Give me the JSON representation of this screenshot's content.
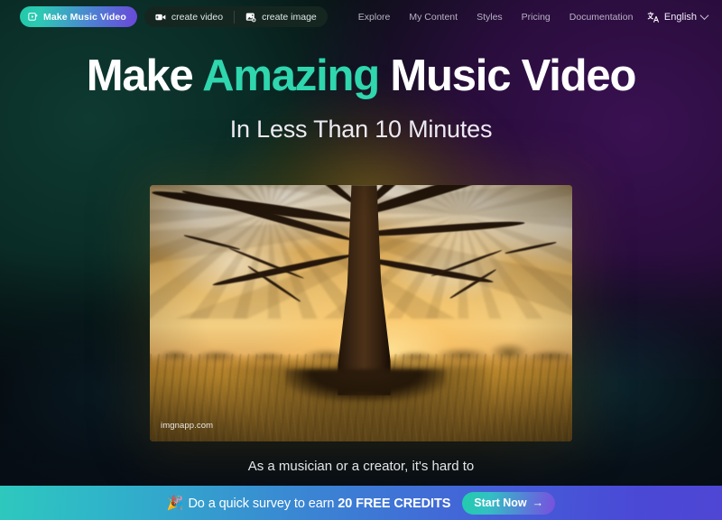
{
  "navbar": {
    "primary_pill": {
      "label": "Make Music Video",
      "icon": "video-play-square-icon"
    },
    "pills": [
      {
        "label": "create video",
        "icon": "video-camera-icon"
      },
      {
        "label": "create image",
        "icon": "image-plus-icon"
      }
    ],
    "links": [
      "Explore",
      "My Content",
      "Styles",
      "Pricing",
      "Documentation"
    ],
    "language": {
      "label": "English",
      "icon": "translate-icon",
      "chevron": "chevron-down-icon"
    }
  },
  "hero": {
    "headline_part1": "Make ",
    "headline_accent": "Amazing",
    "headline_part2": " Music Video",
    "subhead": "In Less Than 10 Minutes",
    "body_text": "As a musician or a creator, it's hard to"
  },
  "media": {
    "watermark": "imgnapp.com",
    "alt": "golden-hour oak tree in a sunlit field"
  },
  "banner": {
    "emoji": "🎉",
    "text_lead": "Do a quick survey to earn ",
    "text_strong": "20 FREE CREDITS",
    "cta_label": "Start Now",
    "cta_arrow": "→"
  },
  "colors": {
    "accent_teal": "#2fd6ae",
    "purple": "#6b46d9",
    "banner_start": "#2ec8bd",
    "banner_end": "#4f46d4",
    "bg_dark": "#06100f"
  }
}
